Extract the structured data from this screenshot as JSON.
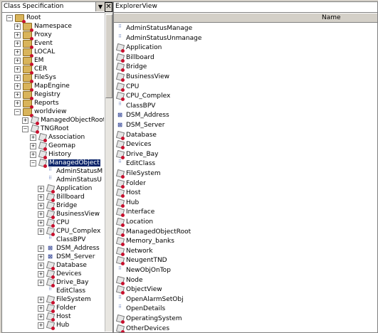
{
  "left_pane": {
    "combo_label": "Class Specification",
    "combo_arrow": "▼",
    "close_glyph": "✕",
    "tree": [
      {
        "label": "Root",
        "depth": 0,
        "expander": "−",
        "icon": "folder-icon"
      },
      {
        "label": "Namespace",
        "depth": 1,
        "expander": "+",
        "icon": "folder-icon"
      },
      {
        "label": "Proxy",
        "depth": 1,
        "expander": "+",
        "icon": "folder-icon"
      },
      {
        "label": "Event",
        "depth": 1,
        "expander": "+",
        "icon": "folder-icon"
      },
      {
        "label": "LOCAL",
        "depth": 1,
        "expander": "+",
        "icon": "folder-icon"
      },
      {
        "label": "EM",
        "depth": 1,
        "expander": "+",
        "icon": "folder-icon"
      },
      {
        "label": "CER",
        "depth": 1,
        "expander": "+",
        "icon": "folder-icon"
      },
      {
        "label": "FileSys",
        "depth": 1,
        "expander": "+",
        "icon": "folder-icon"
      },
      {
        "label": "MapEngine",
        "depth": 1,
        "expander": "+",
        "icon": "folder-icon"
      },
      {
        "label": "Registry",
        "depth": 1,
        "expander": "+",
        "icon": "folder-icon"
      },
      {
        "label": "Reports",
        "depth": 1,
        "expander": "+",
        "icon": "folder-icon"
      },
      {
        "label": "worldview",
        "depth": 1,
        "expander": "−",
        "icon": "folder-icon"
      },
      {
        "label": "ManagedObjectRoot",
        "depth": 2,
        "expander": "+",
        "icon": "class-icon"
      },
      {
        "label": "TNGRoot",
        "depth": 2,
        "expander": "−",
        "icon": "class-icon"
      },
      {
        "label": "Association",
        "depth": 3,
        "expander": "+",
        "icon": "class-icon"
      },
      {
        "label": "Geomap",
        "depth": 3,
        "expander": "+",
        "icon": "class-icon"
      },
      {
        "label": "History",
        "depth": 3,
        "expander": "+",
        "icon": "class-icon"
      },
      {
        "label": "ManagedObject",
        "depth": 3,
        "expander": "−",
        "icon": "class-icon",
        "selected": true
      },
      {
        "label": "AdminStatusM",
        "depth": 4,
        "expander": "",
        "icon": "attribute-icon"
      },
      {
        "label": "AdminStatusU",
        "depth": 4,
        "expander": "",
        "icon": "attribute-icon"
      },
      {
        "label": "Application",
        "depth": 4,
        "expander": "+",
        "icon": "class-icon"
      },
      {
        "label": "Billboard",
        "depth": 4,
        "expander": "+",
        "icon": "class-icon"
      },
      {
        "label": "Bridge",
        "depth": 4,
        "expander": "+",
        "icon": "class-icon"
      },
      {
        "label": "BusinessView",
        "depth": 4,
        "expander": "+",
        "icon": "class-icon"
      },
      {
        "label": "CPU",
        "depth": 4,
        "expander": "+",
        "icon": "class-icon"
      },
      {
        "label": "CPU_Complex",
        "depth": 4,
        "expander": "+",
        "icon": "class-icon"
      },
      {
        "label": "ClassBPV",
        "depth": 4,
        "expander": "",
        "icon": "attribute-icon"
      },
      {
        "label": "DSM_Address",
        "depth": 4,
        "expander": "+",
        "icon": "dsm-icon"
      },
      {
        "label": "DSM_Server",
        "depth": 4,
        "expander": "+",
        "icon": "dsm-icon"
      },
      {
        "label": "Database",
        "depth": 4,
        "expander": "+",
        "icon": "class-icon"
      },
      {
        "label": "Devices",
        "depth": 4,
        "expander": "+",
        "icon": "class-icon"
      },
      {
        "label": "Drive_Bay",
        "depth": 4,
        "expander": "+",
        "icon": "class-icon"
      },
      {
        "label": "EditClass",
        "depth": 4,
        "expander": "",
        "icon": "attribute-icon"
      },
      {
        "label": "FileSystem",
        "depth": 4,
        "expander": "+",
        "icon": "class-icon"
      },
      {
        "label": "Folder",
        "depth": 4,
        "expander": "+",
        "icon": "class-icon"
      },
      {
        "label": "Host",
        "depth": 4,
        "expander": "+",
        "icon": "class-icon"
      },
      {
        "label": "Hub",
        "depth": 4,
        "expander": "+",
        "icon": "class-icon"
      }
    ]
  },
  "right_pane": {
    "title": "ExplorerView",
    "column_name": "Name",
    "items": [
      {
        "label": "AdminStatusManage",
        "icon": "attribute-icon"
      },
      {
        "label": "AdminStatusUnmanage",
        "icon": "attribute-icon"
      },
      {
        "label": "Application",
        "icon": "class-icon"
      },
      {
        "label": "Billboard",
        "icon": "class-icon"
      },
      {
        "label": "Bridge",
        "icon": "class-icon"
      },
      {
        "label": "BusinessView",
        "icon": "class-icon"
      },
      {
        "label": "CPU",
        "icon": "class-icon"
      },
      {
        "label": "CPU_Complex",
        "icon": "class-icon"
      },
      {
        "label": "ClassBPV",
        "icon": "attribute-icon"
      },
      {
        "label": "DSM_Address",
        "icon": "dsm-icon"
      },
      {
        "label": "DSM_Server",
        "icon": "dsm-icon"
      },
      {
        "label": "Database",
        "icon": "class-icon"
      },
      {
        "label": "Devices",
        "icon": "class-icon"
      },
      {
        "label": "Drive_Bay",
        "icon": "class-icon"
      },
      {
        "label": "EditClass",
        "icon": "attribute-icon"
      },
      {
        "label": "FileSystem",
        "icon": "class-icon"
      },
      {
        "label": "Folder",
        "icon": "class-icon"
      },
      {
        "label": "Host",
        "icon": "class-icon"
      },
      {
        "label": "Hub",
        "icon": "class-icon"
      },
      {
        "label": "Interface",
        "icon": "class-icon"
      },
      {
        "label": "Location",
        "icon": "class-icon"
      },
      {
        "label": "ManagedObjectRoot",
        "icon": "class-icon"
      },
      {
        "label": "Memory_banks",
        "icon": "class-icon"
      },
      {
        "label": "Network",
        "icon": "class-icon"
      },
      {
        "label": "NeugentTND",
        "icon": "class-icon"
      },
      {
        "label": "NewObjOnTop",
        "icon": "attribute-icon"
      },
      {
        "label": "Node",
        "icon": "class-icon"
      },
      {
        "label": "ObjectView",
        "icon": "class-icon"
      },
      {
        "label": "OpenAlarmSetObj",
        "icon": "attribute-icon"
      },
      {
        "label": "OpenDetails",
        "icon": "attribute-icon"
      },
      {
        "label": "OperatingSystem",
        "icon": "class-icon"
      },
      {
        "label": "OtherDevices",
        "icon": "class-icon"
      }
    ]
  },
  "colors": {
    "selection": "#0a246a",
    "panel": "#d4d0c8",
    "marker_red": "#c8102e"
  }
}
